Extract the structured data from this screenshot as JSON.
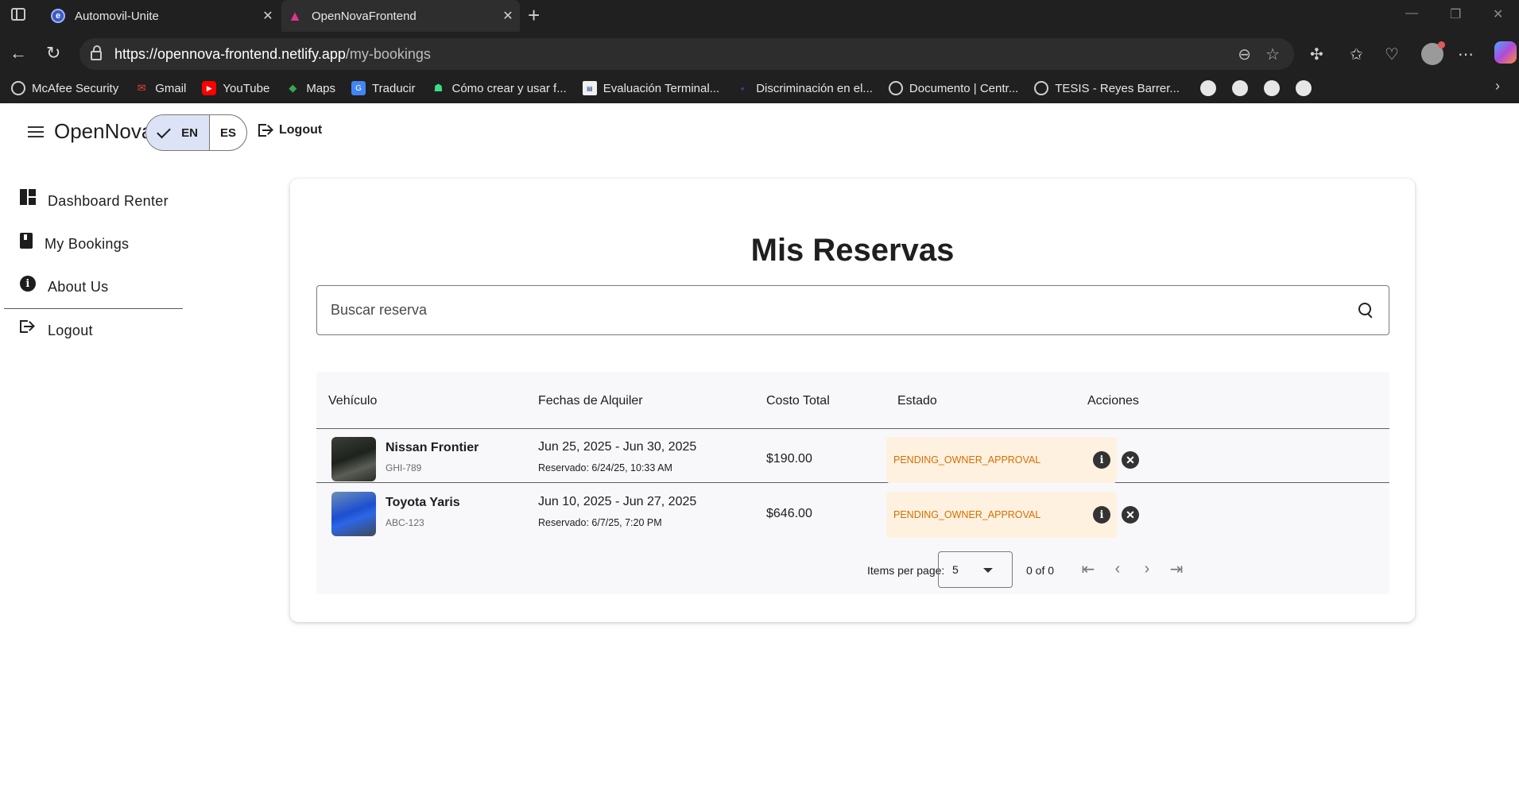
{
  "browser": {
    "tabs": [
      {
        "title": "Automovil-Unite"
      },
      {
        "title": "OpenNovaFrontend"
      }
    ],
    "url_host": "https://opennova-frontend.netlify.app",
    "url_path": "/my-bookings",
    "bookmarks": [
      {
        "label": "McAfee Security",
        "icon": "globe-icon"
      },
      {
        "label": "Gmail",
        "icon": "gmail-icon"
      },
      {
        "label": "YouTube",
        "icon": "youtube-icon"
      },
      {
        "label": "Maps",
        "icon": "maps-icon"
      },
      {
        "label": "Traducir",
        "icon": "translate-icon"
      },
      {
        "label": "Cómo crear y usar f...",
        "icon": "android-icon"
      },
      {
        "label": "Evaluación Terminal...",
        "icon": "doc-icon"
      },
      {
        "label": "Discriminación en el...",
        "icon": "dot-icon"
      },
      {
        "label": "Documento | Centr...",
        "icon": "globe-icon"
      },
      {
        "label": "TESIS - Reyes Barrer...",
        "icon": "globe-icon"
      }
    ]
  },
  "app": {
    "brand": "OpenNova",
    "lang": {
      "en": "EN",
      "es": "ES"
    },
    "header_logout": "Logout"
  },
  "sidebar": {
    "items": [
      {
        "label": "Dashboard Renter"
      },
      {
        "label": "My Bookings"
      },
      {
        "label": "About Us"
      },
      {
        "label": "Logout"
      }
    ]
  },
  "main": {
    "title": "Mis Reservas",
    "search_placeholder": "Buscar reserva",
    "columns": [
      "Vehículo",
      "Fechas de Alquiler",
      "Costo Total",
      "Estado",
      "Acciones"
    ],
    "rows": [
      {
        "vehicle": "Nissan Frontier",
        "plate": "GHI-789",
        "dates": "Jun 25, 2025 - Jun 30, 2025",
        "booked": "Reservado: 6/24/25, 10:33 AM",
        "cost": "$190.00",
        "status": "PENDING_OWNER_APPROVAL"
      },
      {
        "vehicle": "Toyota Yaris",
        "plate": "ABC-123",
        "dates": "Jun 10, 2025 - Jun 27, 2025",
        "booked": "Reservado: 6/7/25, 7:20 PM",
        "cost": "$646.00",
        "status": "PENDING_OWNER_APPROVAL"
      }
    ],
    "pager": {
      "label": "Items per page:",
      "page_size": "5",
      "range": "0 of 0"
    }
  },
  "colors": {
    "status_bg": "#fff1e0",
    "status_text": "#d46f00",
    "lang_selected_bg": "#dce3f7"
  }
}
